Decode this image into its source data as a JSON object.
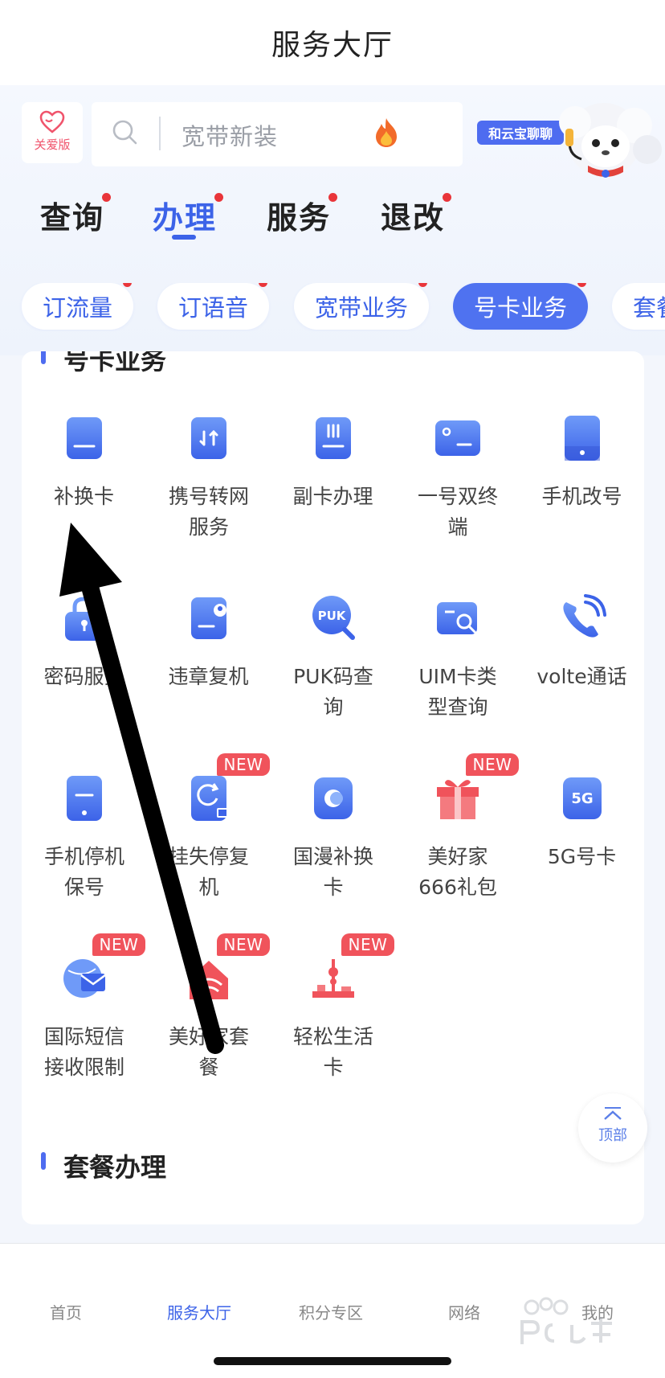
{
  "header": {
    "title": "服务大厅"
  },
  "care": {
    "label": "关爱版"
  },
  "search": {
    "placeholder": "宽带新装"
  },
  "mascot": {
    "badge": "和云宝聊聊"
  },
  "categories": [
    {
      "label": "查询",
      "active": false
    },
    {
      "label": "办理",
      "active": true
    },
    {
      "label": "服务",
      "active": false
    },
    {
      "label": "退改",
      "active": false
    }
  ],
  "chips": [
    {
      "label": "订流量"
    },
    {
      "label": "订语音"
    },
    {
      "label": "宽带业务"
    },
    {
      "label": "号卡业务",
      "active": true
    },
    {
      "label": "套餐"
    }
  ],
  "section1": {
    "title": "号卡业务"
  },
  "items": [
    {
      "label": "补换卡",
      "icon": "sim-card-icon"
    },
    {
      "label": "携号转网服务",
      "icon": "transfer-icon"
    },
    {
      "label": "副卡办理",
      "icon": "sub-card-icon"
    },
    {
      "label": "一号双终端",
      "icon": "dual-terminal-icon"
    },
    {
      "label": "手机改号",
      "icon": "phone-icon"
    },
    {
      "label": "密码服务",
      "icon": "lock-icon"
    },
    {
      "label": "违章复机",
      "icon": "restore-icon"
    },
    {
      "label": "PUK码查询",
      "icon": "puk-search-icon"
    },
    {
      "label": "UIM卡类型查询",
      "icon": "card-search-icon"
    },
    {
      "label": "volte通话",
      "icon": "call-icon"
    },
    {
      "label": "手机停机保号",
      "icon": "suspend-icon"
    },
    {
      "label": "挂失停复机",
      "icon": "report-loss-icon",
      "badge": "NEW"
    },
    {
      "label": "国漫补换卡",
      "icon": "roaming-icon"
    },
    {
      "label": "美好家666礼包",
      "icon": "gift-icon",
      "badge": "NEW"
    },
    {
      "label": "5G号卡",
      "icon": "5g-icon"
    },
    {
      "label": "国际短信接收限制",
      "icon": "intl-sms-icon",
      "badge": "NEW"
    },
    {
      "label": "美好家套餐",
      "icon": "home-package-icon",
      "badge": "NEW"
    },
    {
      "label": "轻松生活卡",
      "icon": "life-card-icon",
      "badge": "NEW"
    }
  ],
  "section2": {
    "title": "套餐办理"
  },
  "top_button": {
    "label": "顶部"
  },
  "tabbar": [
    {
      "label": "首页"
    },
    {
      "label": "服务大厅",
      "active": true
    },
    {
      "label": "积分专区"
    },
    {
      "label": "网络"
    },
    {
      "label": "我的"
    }
  ],
  "colors": {
    "accent": "#3c63e8",
    "badge": "#f0535b",
    "dot": "#e9353a"
  }
}
